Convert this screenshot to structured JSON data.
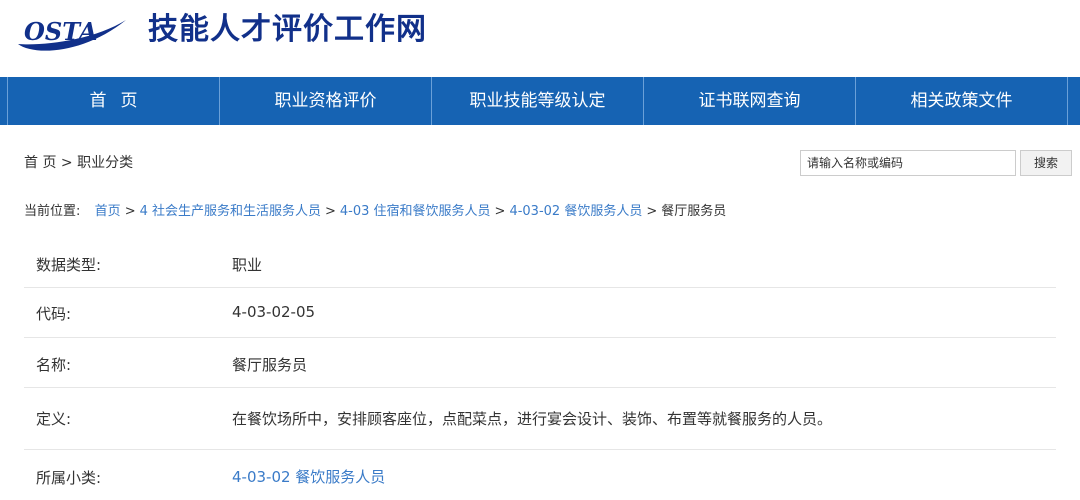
{
  "header": {
    "logo_text": "OSTA",
    "site_title": "技能人才评价工作网"
  },
  "nav": {
    "items": [
      {
        "label": "首页"
      },
      {
        "label": "职业资格评价"
      },
      {
        "label": "职业技能等级认定"
      },
      {
        "label": "证书联网查询"
      },
      {
        "label": "相关政策文件"
      }
    ]
  },
  "breadcrumb": {
    "home": "首 页",
    "sep": ">",
    "current": "职业分类"
  },
  "search": {
    "placeholder": "请输入名称或编码",
    "button_label": "搜索"
  },
  "location": {
    "prefix": "当前位置:",
    "links": [
      "首页",
      "4 社会生产服务和生活服务人员",
      "4-03 住宿和餐饮服务人员",
      "4-03-02 餐饮服务人员"
    ],
    "current": "餐厅服务员",
    "sep": ">"
  },
  "details": [
    {
      "label": "数据类型:",
      "value": "职业"
    },
    {
      "label": "代码:",
      "value": "4-03-02-05"
    },
    {
      "label": "名称:",
      "value": "餐厅服务员"
    },
    {
      "label": "定义:",
      "value": "在餐饮场所中，安排顾客座位，点配菜点，进行宴会设计、装饰、布置等就餐服务的人员。"
    },
    {
      "label": "所属小类:",
      "value": "4-03-02 餐饮服务人员"
    }
  ],
  "colors": {
    "nav_bg": "#1663b3",
    "title": "#11308a",
    "link": "#3a7bc8"
  }
}
